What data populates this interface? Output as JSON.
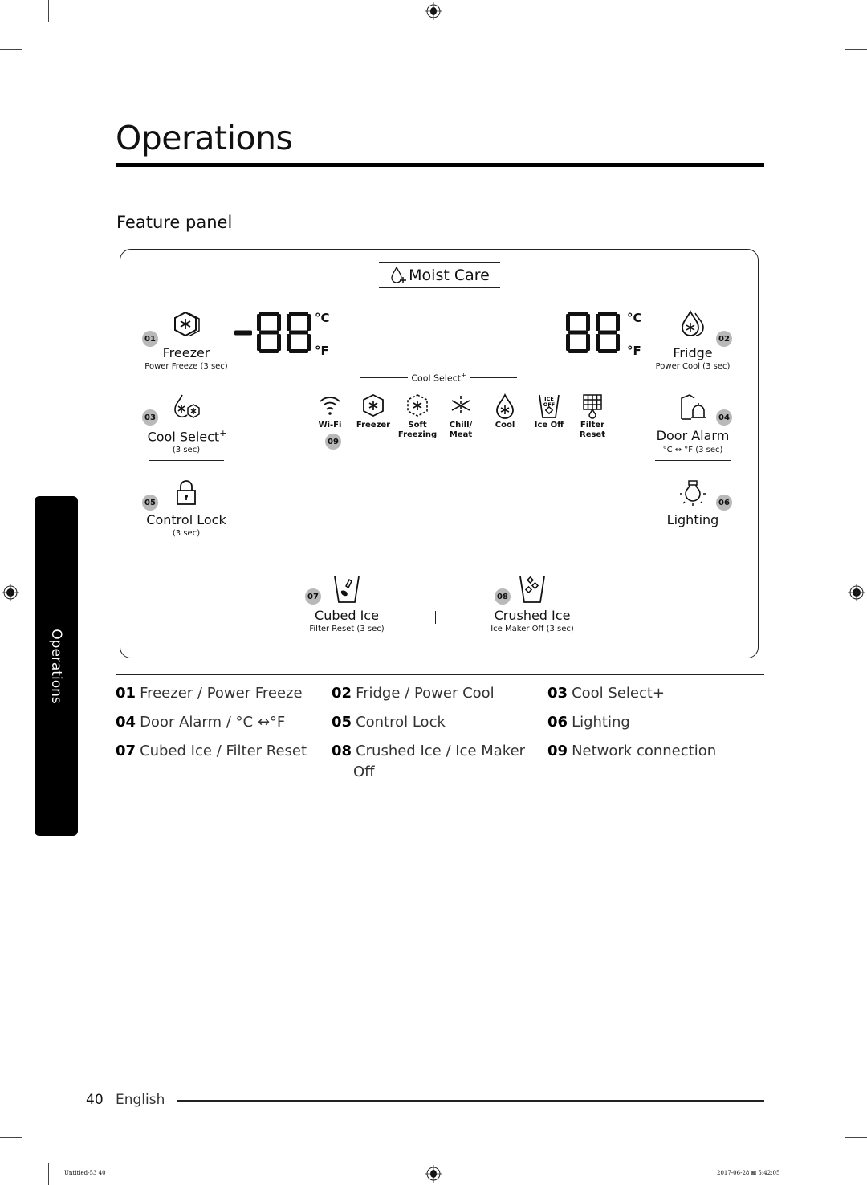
{
  "header": {
    "title": "Operations",
    "section_title": "Feature panel"
  },
  "side_tab": {
    "label": "Operations"
  },
  "panel": {
    "moist_care": {
      "label": "Moist Care",
      "icon": "drop-plus-icon"
    },
    "freezer_display": {
      "digits": "-88",
      "unit_c": "°C",
      "unit_f": "°F"
    },
    "fridge_display": {
      "digits": "88",
      "unit_c": "°C",
      "unit_f": "°F"
    },
    "features": [
      {
        "number": "01",
        "label": "Freezer",
        "sub": "Power Freeze (3 sec)",
        "icon": "freezer-hexagon-icon"
      },
      {
        "number": "02",
        "label": "Fridge",
        "sub": "Power Cool (3 sec)",
        "icon": "fridge-drops-icon"
      },
      {
        "number": "03",
        "label": "Cool Select",
        "label_sup": "+",
        "sub": "(3 sec)",
        "icon": "cool-select-icon"
      },
      {
        "number": "04",
        "label": "Door Alarm",
        "sub": "°C ↔ °F (3 sec)",
        "icon": "door-alarm-icon"
      },
      {
        "number": "05",
        "label": "Control Lock",
        "sub": "(3 sec)",
        "icon": "lock-icon"
      },
      {
        "number": "06",
        "label": "Lighting",
        "sub": "",
        "icon": "light-bulb-icon"
      },
      {
        "number": "07",
        "label": "Cubed Ice",
        "sub": "Filter Reset (3 sec)",
        "icon": "cubed-ice-icon"
      },
      {
        "number": "08",
        "label": "Crushed Ice",
        "sub": "Ice Maker Off (3 sec)",
        "icon": "crushed-ice-icon"
      }
    ],
    "cool_select_header": {
      "label": "Cool Select",
      "sup": "+"
    },
    "indicators": [
      {
        "label": "Wi-Fi",
        "icon": "wifi-icon"
      },
      {
        "label": "Freezer",
        "icon": "freezer-hexagon-icon"
      },
      {
        "label": "Soft\nFreezing",
        "line1": "Soft",
        "line2": "Freezing",
        "icon": "soft-freezing-icon"
      },
      {
        "label": "Chill/\nMeat",
        "line1": "Chill/",
        "line2": "Meat",
        "icon": "chill-meat-icon"
      },
      {
        "label": "Cool",
        "icon": "cool-drop-icon"
      },
      {
        "label": "Ice Off",
        "icon": "ice-off-icon",
        "icon_text1": "ICE",
        "icon_text2": "OFF"
      },
      {
        "label": "Filter\nReset",
        "line1": "Filter",
        "line2": "Reset",
        "icon": "filter-reset-icon"
      }
    ],
    "wifi_badge": "09"
  },
  "legend": [
    {
      "num": "01",
      "text": "Freezer / Power Freeze"
    },
    {
      "num": "02",
      "text": "Fridge / Power Cool"
    },
    {
      "num": "03",
      "text": "Cool Select+"
    },
    {
      "num": "04",
      "text": "Door Alarm / °C ↔°F"
    },
    {
      "num": "05",
      "text": "Control Lock"
    },
    {
      "num": "06",
      "text": "Lighting"
    },
    {
      "num": "07",
      "text": "Cubed Ice / Filter Reset"
    },
    {
      "num": "08",
      "text": "Crushed Ice / Ice Maker",
      "text2": "Off"
    },
    {
      "num": "09",
      "text": "Network connection"
    }
  ],
  "footer": {
    "page_number": "40",
    "language": "English",
    "print_file": "Untitled-53   40",
    "print_date": "2017-06-28  ▩ 5:42:05"
  }
}
